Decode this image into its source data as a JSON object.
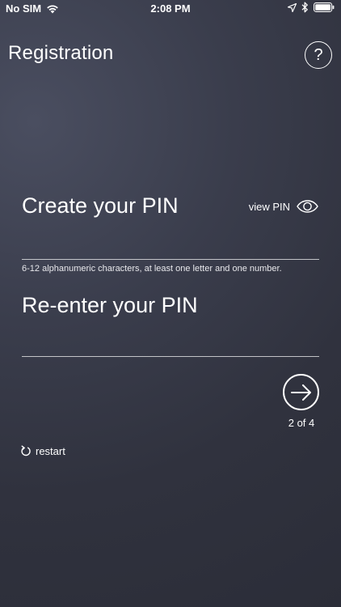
{
  "status_bar": {
    "carrier": "No SIM",
    "time": "2:08 PM"
  },
  "header": {
    "title": "Registration",
    "help_label": "?"
  },
  "pin_form": {
    "create_label": "Create your PIN",
    "view_pin_label": "view PIN",
    "hint": "6-12 alphanumeric characters, at least one letter and one number.",
    "reenter_label": "Re-enter your PIN",
    "create_value": "",
    "reenter_value": ""
  },
  "navigation": {
    "step": "2 of 4",
    "restart_label": "restart"
  },
  "icons": {
    "wifi": "wifi-icon",
    "location": "location-arrow-icon",
    "bluetooth": "bluetooth-icon",
    "battery": "battery-icon",
    "eye": "eye-icon",
    "next": "arrow-right-circle-icon",
    "restart": "restart-icon"
  },
  "colors": {
    "background": "#363946",
    "foreground": "#ffffff"
  }
}
